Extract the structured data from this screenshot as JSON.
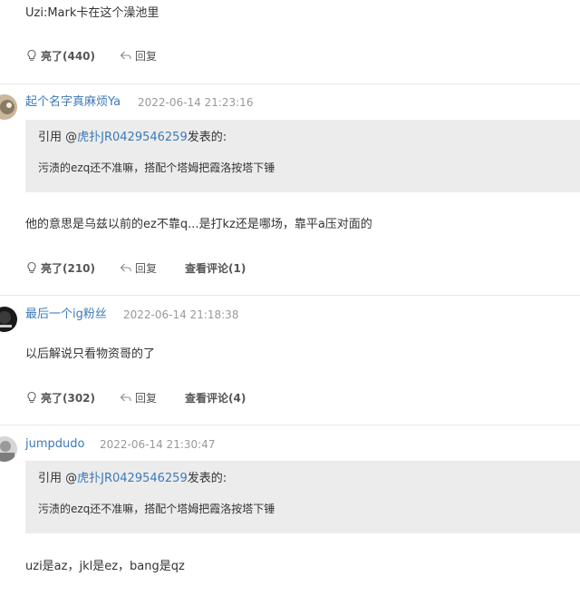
{
  "colors": {
    "link": "#3d7ab8",
    "quote_bg": "#ececec",
    "divider": "#e8e8e8",
    "meta": "#999999"
  },
  "top_post": {
    "text": "Uzi:Mark卡在这个澡池里",
    "like_label": "亮了(440)",
    "reply_label": "回复"
  },
  "posts": [
    {
      "username": "起个名字真麻烦Ya",
      "time": "2022-06-14 21:23:16",
      "quote": {
        "prefix": "引用 @",
        "user": "虎扑JR0429546259",
        "suffix": "发表的:",
        "text": "污渍的ezq还不准嘛，搭配个塔姆把霞洛按塔下锤"
      },
      "text": "他的意思是乌兹以前的ez不靠q...是打kz还是哪场，靠平a压对面的",
      "like_label": "亮了(210)",
      "reply_label": "回复",
      "comments_label": "查看评论(1)"
    },
    {
      "username": "最后一个ig粉丝",
      "time": "2022-06-14 21:18:38",
      "text": "以后解说只看物资哥的了",
      "like_label": "亮了(302)",
      "reply_label": "回复",
      "comments_label": "查看评论(4)"
    },
    {
      "username": "jumpdudo",
      "time": "2022-06-14 21:30:47",
      "quote": {
        "prefix": "引用 @",
        "user": "虎扑JR0429546259",
        "suffix": "发表的:",
        "text": "污渍的ezq还不准嘛，搭配个塔姆把霞洛按塔下锤"
      },
      "text": "uzi是az，jkl是ez，bang是qz"
    }
  ],
  "icons": {
    "like": "lightbulb-icon",
    "reply": "reply-arrow-icon"
  }
}
